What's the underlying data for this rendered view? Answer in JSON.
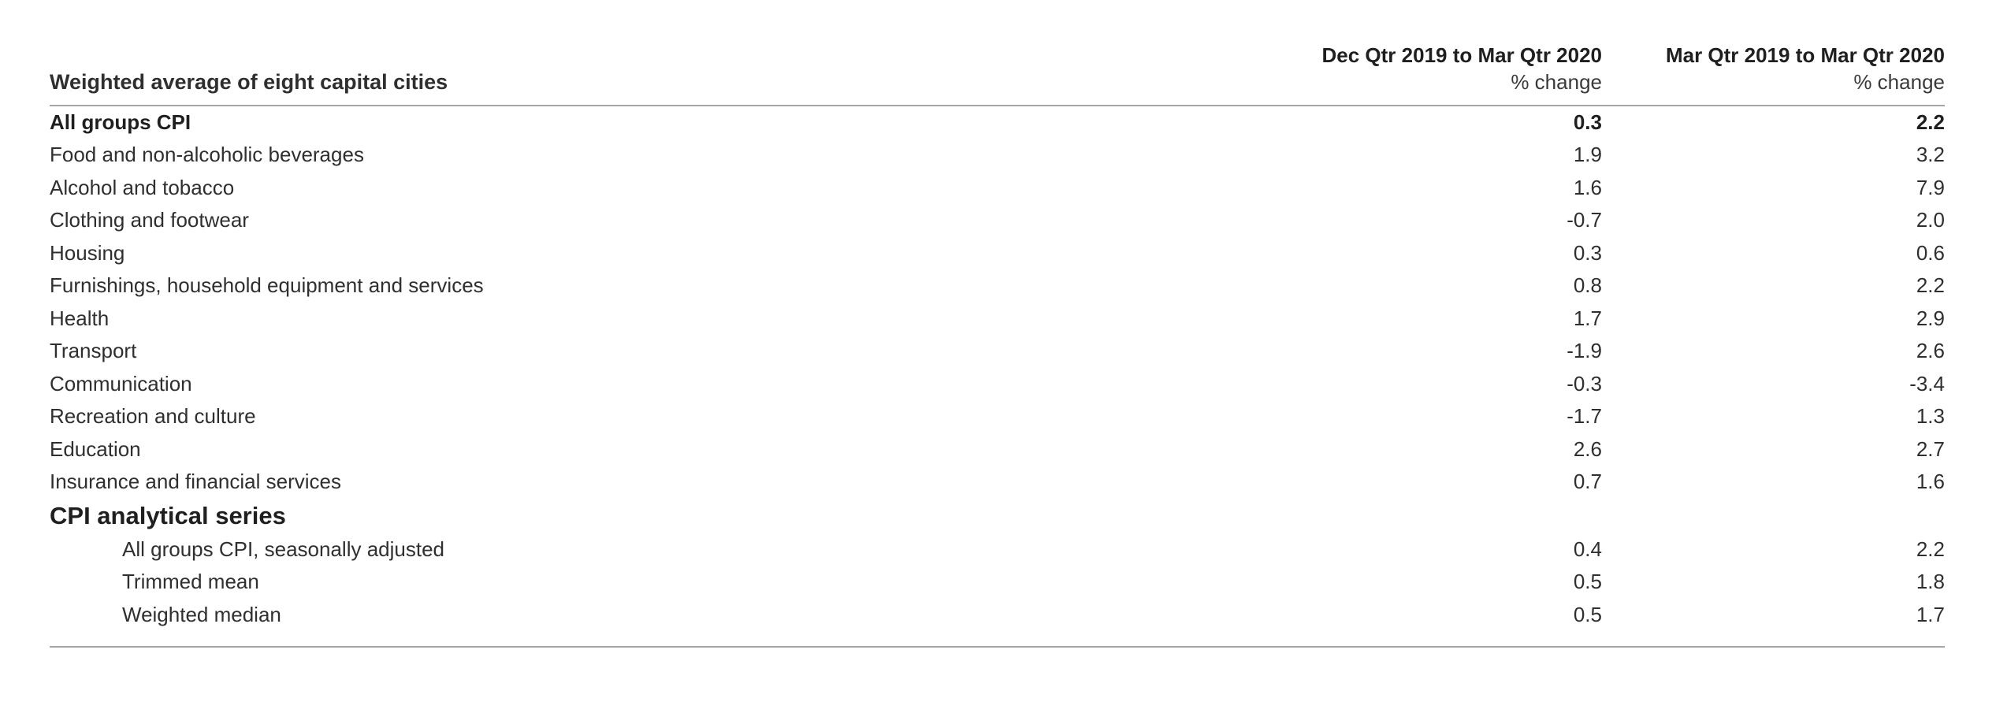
{
  "table": {
    "row_header_label": "Weighted average of eight capital cities",
    "columns": [
      {
        "period": "Dec Qtr 2019 to Mar Qtr 2020",
        "unit": "% change"
      },
      {
        "period": "Mar Qtr 2019 to Mar Qtr 2020",
        "unit": "% change"
      }
    ],
    "rows": [
      {
        "label": "All groups CPI",
        "v1": "0.3",
        "v2": "2.2",
        "style": "strong",
        "indent": 0
      },
      {
        "label": "Food and non-alcoholic beverages",
        "v1": "1.9",
        "v2": "3.2",
        "style": "normal",
        "indent": 0
      },
      {
        "label": "Alcohol and tobacco",
        "v1": "1.6",
        "v2": "7.9",
        "style": "normal",
        "indent": 0
      },
      {
        "label": "Clothing and footwear",
        "v1": "-0.7",
        "v2": "2.0",
        "style": "normal",
        "indent": 0
      },
      {
        "label": "Housing",
        "v1": "0.3",
        "v2": "0.6",
        "style": "normal",
        "indent": 0
      },
      {
        "label": "Furnishings, household equipment and services",
        "v1": "0.8",
        "v2": "2.2",
        "style": "normal",
        "indent": 0
      },
      {
        "label": "Health",
        "v1": "1.7",
        "v2": "2.9",
        "style": "normal",
        "indent": 0
      },
      {
        "label": "Transport",
        "v1": "-1.9",
        "v2": "2.6",
        "style": "normal",
        "indent": 0
      },
      {
        "label": "Communication",
        "v1": "-0.3",
        "v2": "-3.4",
        "style": "normal",
        "indent": 0
      },
      {
        "label": "Recreation and culture",
        "v1": "-1.7",
        "v2": "1.3",
        "style": "normal",
        "indent": 0
      },
      {
        "label": "Education",
        "v1": "2.6",
        "v2": "2.7",
        "style": "normal",
        "indent": 0
      },
      {
        "label": "Insurance and financial services",
        "v1": "0.7",
        "v2": "1.6",
        "style": "normal",
        "indent": 0
      },
      {
        "label": "CPI analytical series",
        "v1": "",
        "v2": "",
        "style": "section",
        "indent": 0
      },
      {
        "label": "All groups CPI, seasonally adjusted",
        "v1": "0.4",
        "v2": "2.2",
        "style": "normal",
        "indent": 1
      },
      {
        "label": "Trimmed mean",
        "v1": "0.5",
        "v2": "1.8",
        "style": "normal",
        "indent": 1
      },
      {
        "label": "Weighted median",
        "v1": "0.5",
        "v2": "1.7",
        "style": "normal",
        "indent": 1
      }
    ]
  },
  "colors": {
    "rule": "#a6a6a6",
    "text": "#2f2f2f",
    "text_strong": "#1f1f1f",
    "background": "#ffffff"
  }
}
